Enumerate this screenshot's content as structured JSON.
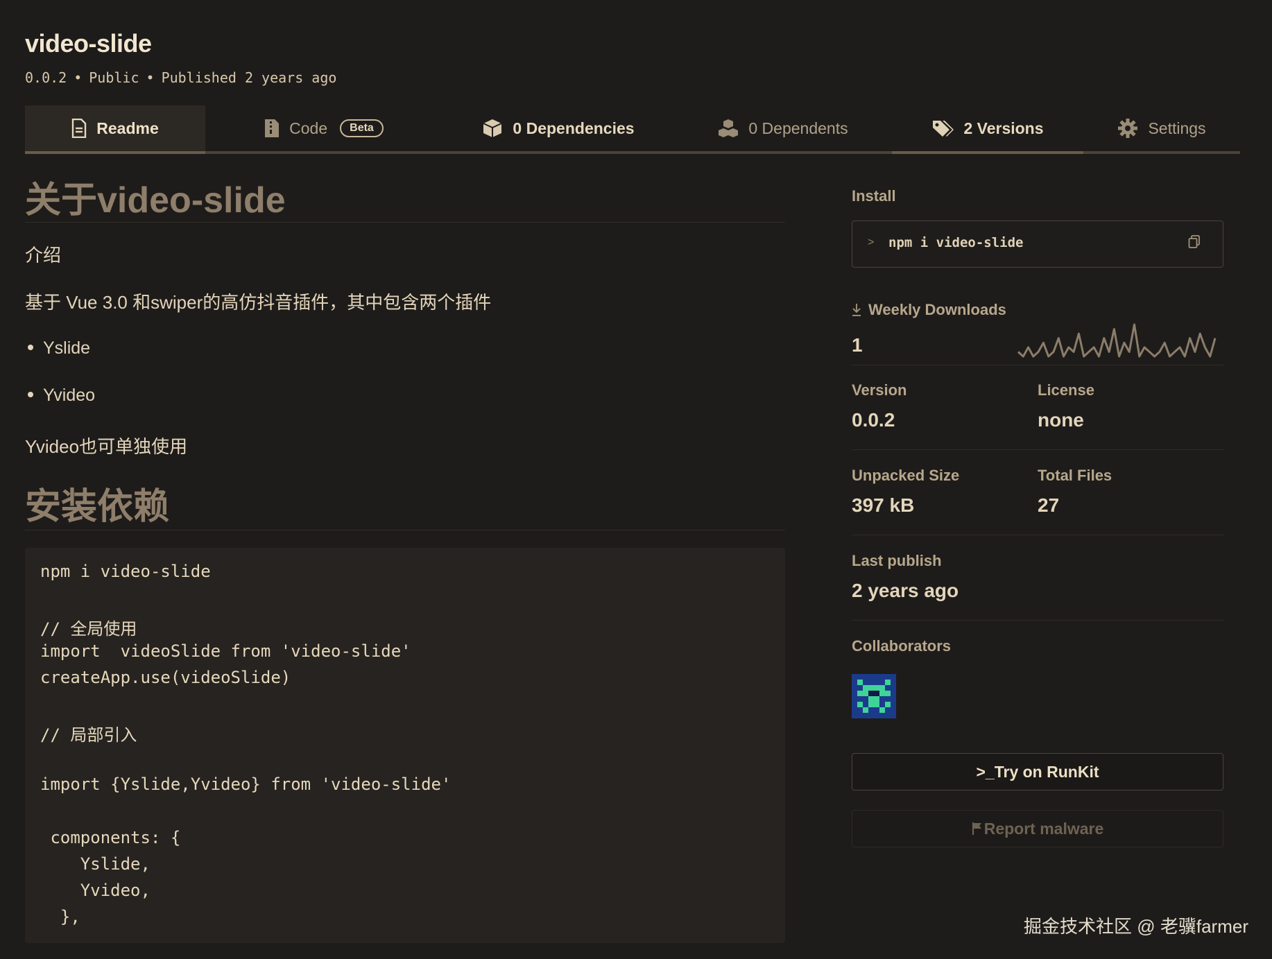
{
  "header": {
    "title": "video-slide",
    "version": "0.0.2",
    "visibility": "Public",
    "published": "Published 2 years ago",
    "separator": "•"
  },
  "tabs": [
    {
      "label": "Readme",
      "icon": "readme-icon",
      "active": true
    },
    {
      "label": "Code",
      "icon": "code-file-icon",
      "badge": "Beta"
    },
    {
      "label": "0 Dependencies",
      "icon": "box-icon"
    },
    {
      "label": "0 Dependents",
      "icon": "boxes-icon"
    },
    {
      "label": "2 Versions",
      "icon": "tags-icon"
    },
    {
      "label": "Settings",
      "icon": "gear-icon"
    }
  ],
  "readme": {
    "h1_about": "关于video-slide",
    "intro_label": "介绍",
    "intro_text": "基于 Vue 3.0 和swiper的高仿抖音插件，其中包含两个插件",
    "list": [
      "Yslide",
      "Yvideo"
    ],
    "note": "Yvideo也可单独使用",
    "h1_install": "安装依赖",
    "code": [
      "npm i video-slide",
      "",
      "// 全局使用",
      "import  videoSlide from 'video-slide'",
      "createApp.use(videoSlide)",
      "",
      "// 局部引入",
      "",
      "import {Yslide,Yvideo} from 'video-slide'",
      "",
      " components: {",
      "    Yslide,",
      "    Yvideo,",
      "  },"
    ]
  },
  "sidebar": {
    "install_label": "Install",
    "install_prompt": ">",
    "install_cmd": "npm i video-slide",
    "weekly_label": "Weekly Downloads",
    "weekly_value": "1",
    "weekly_series": [
      2,
      1,
      3,
      1,
      2,
      4,
      1,
      2,
      5,
      1,
      3,
      2,
      6,
      1,
      2,
      3,
      1,
      5,
      2,
      7,
      1,
      4,
      2,
      8,
      1,
      3,
      2,
      1,
      2,
      4,
      1,
      2,
      3,
      1,
      5,
      2,
      6,
      3,
      1,
      5
    ],
    "version_label": "Version",
    "version_value": "0.0.2",
    "license_label": "License",
    "license_value": "none",
    "unpacked_label": "Unpacked Size",
    "unpacked_value": "397 kB",
    "files_label": "Total Files",
    "files_value": "27",
    "last_publish_label": "Last publish",
    "last_publish_value": "2 years ago",
    "collaborators_label": "Collaborators",
    "runkit_button": "Try on RunKit",
    "runkit_prefix": ">_",
    "report_button": "Report malware"
  },
  "watermark": "掘金技术社区 @ 老骥farmer",
  "colors": {
    "background": "#1e1c1a",
    "heading_muted": "#8e7e6a",
    "text": "#e3d5bb",
    "avatar_bg": "#1b3b8a",
    "avatar_fg": "#3fd39a"
  }
}
